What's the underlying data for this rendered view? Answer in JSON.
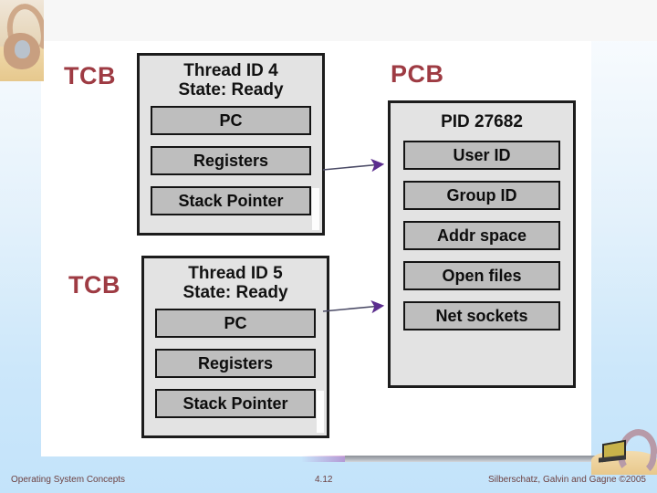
{
  "slide": {
    "page_number": "4.12",
    "footer_left": "Operating System Concepts",
    "footer_right": "Silberschatz, Galvin and Gagne ©2005",
    "accent_label_color": "#9e3b43",
    "arrow_color": "#5b2d8e",
    "box_fill": "#e3e3e3",
    "field_fill": "#bebebe",
    "panel_background": "#ffffff"
  },
  "diagram": {
    "tcb_blocks": [
      {
        "label": "TCB",
        "title_line1": "Thread ID 4",
        "title_line2": "State: Ready",
        "fields": [
          "PC",
          "Registers",
          "Stack Pointer"
        ]
      },
      {
        "label": "TCB",
        "title_line1": "Thread ID 5",
        "title_line2": "State: Ready",
        "fields": [
          "PC",
          "Registers",
          "Stack Pointer"
        ]
      }
    ],
    "pcb_block": {
      "label": "PCB",
      "title_line1": "PID 27682",
      "title_line2": "",
      "fields": [
        "User ID",
        "Group ID",
        "Addr space",
        "Open files",
        "Net sockets"
      ]
    },
    "connectors": [
      {
        "from": "tcb-block-1",
        "to": "pcb-block",
        "style": "arrow"
      },
      {
        "from": "tcb-block-2",
        "to": "pcb-block",
        "style": "arrow"
      }
    ]
  }
}
